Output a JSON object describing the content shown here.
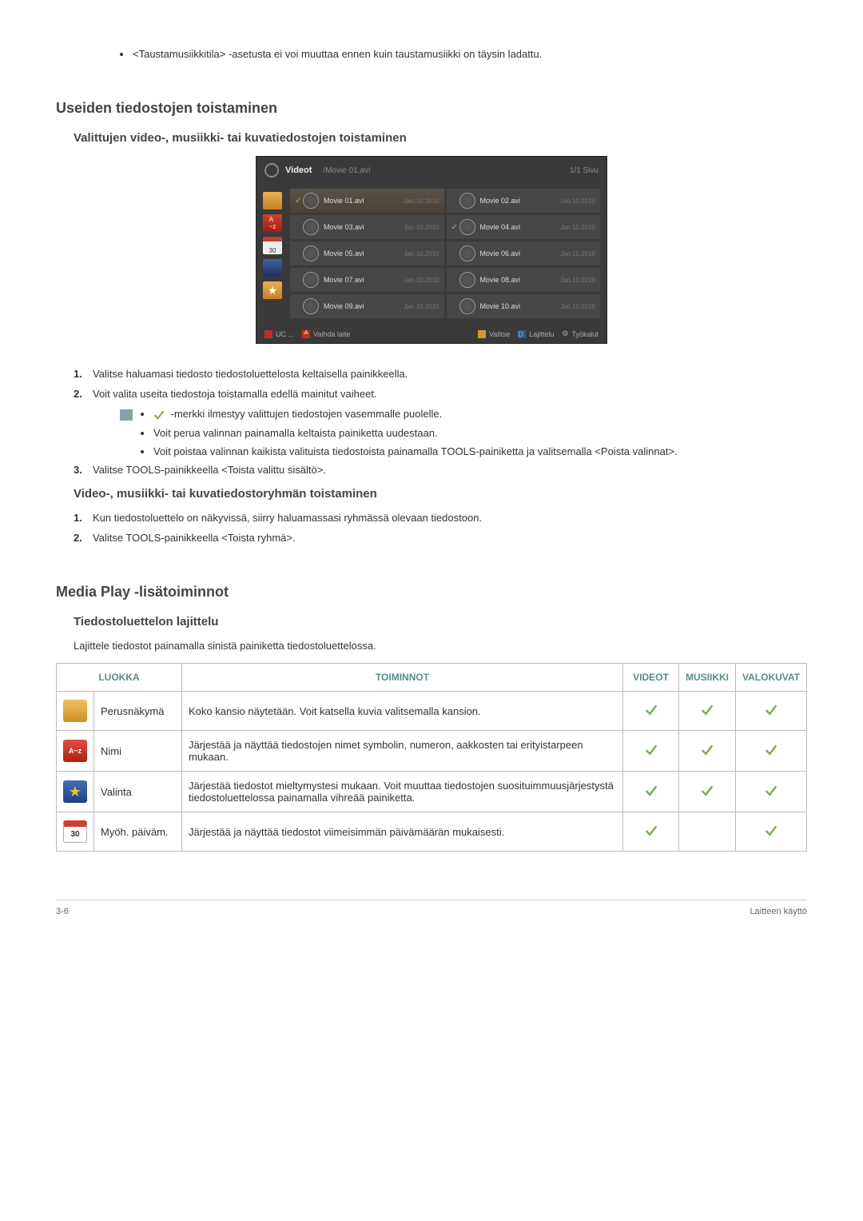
{
  "topNote": "<Taustamusiikkitila> -asetusta ei voi muuttaa ennen kuin taustamusiikki on täysin ladattu.",
  "section1": {
    "heading": "Useiden tiedostojen toistaminen",
    "sub1": {
      "heading": "Valittujen video-, musiikki- tai kuvatiedostojen toistaminen",
      "steps": {
        "s1": "Valitse haluamasi tiedosto tiedostoluettelosta keltaisella painikkeella.",
        "s2": "Voit valita useita tiedostoja toistamalla edellä mainitut vaiheet.",
        "s2a": "-merkki ilmestyy valittujen tiedostojen vasemmalle puolelle.",
        "s2b": "Voit perua valinnan painamalla keltaista painiketta uudestaan.",
        "s2c": "Voit poistaa valinnan kaikista valituista tiedostoista painamalla TOOLS-painiketta ja valitsemalla <Poista valinnat>.",
        "s3": "Valitse TOOLS-painikkeella <Toista valittu sisältö>."
      }
    },
    "sub2": {
      "heading": "Video-, musiikki- tai kuvatiedostoryhmän toistaminen",
      "s1": "Kun tiedostoluettelo on näkyvissä, siirry haluamassasi ryhmässä olevaan tiedostoon.",
      "s2": "Valitse TOOLS-painikkeella <Toista ryhmä>."
    }
  },
  "shot": {
    "title": "Videot",
    "path": "/Movie 01.avi",
    "page": "1/1 Sivu",
    "files": [
      {
        "name": "Movie 01.avi",
        "date": "Jan.10.2010",
        "checked": true,
        "hl": true
      },
      {
        "name": "Movie 02.avi",
        "date": "Jan.10.2010",
        "checked": false,
        "hl": false
      },
      {
        "name": "Movie 03.avi",
        "date": "Jan.10.2010",
        "checked": false,
        "hl": false
      },
      {
        "name": "Movie 04.avi",
        "date": "Jan.10.2010",
        "checked": true,
        "hl": false
      },
      {
        "name": "Movie 05.avi",
        "date": "Jan.10.2010",
        "checked": false,
        "hl": false
      },
      {
        "name": "Movie 06.avi",
        "date": "Jan.10.2010",
        "checked": false,
        "hl": false
      },
      {
        "name": "Movie 07.avi",
        "date": "Jan.10.2010",
        "checked": false,
        "hl": false
      },
      {
        "name": "Movie 08.avi",
        "date": "Jan.10.2010",
        "checked": false,
        "hl": false
      },
      {
        "name": "Movie 09.avi",
        "date": "Jan.10.2010",
        "checked": false,
        "hl": false
      },
      {
        "name": "Movie 10.avi",
        "date": "Jan.10.2010",
        "checked": false,
        "hl": false
      }
    ],
    "footer": {
      "uc": "UC ...",
      "device": "Vaihda laite",
      "select": "Valitse",
      "sort": "Lajittelu",
      "tools": "Työkalut"
    },
    "sideCal": "30"
  },
  "section2": {
    "heading": "Media Play -lisätoiminnot",
    "sub": "Tiedostoluettelon lajittelu",
    "desc": "Lajittele tiedostot painamalla sinistä painiketta tiedostoluettelossa."
  },
  "table": {
    "headers": {
      "cat": "LUOKKA",
      "func": "TOIMINNOT",
      "video": "VIDEOT",
      "music": "MUSIIKKI",
      "photo": "VALOKUVAT"
    },
    "rows": [
      {
        "cat": "Perusnäkymä",
        "func": "Koko kansio näytetään. Voit katsella kuvia valitsemalla kansion.",
        "v": true,
        "m": true,
        "p": true,
        "icon": "folder"
      },
      {
        "cat": "Nimi",
        "func": "Järjestää ja näyttää tiedostojen nimet symbolin, numeron, aakkosten tai erityistarpeen mukaan.",
        "v": true,
        "m": true,
        "p": true,
        "icon": "name"
      },
      {
        "cat": "Valinta",
        "func": "Järjestää tiedostot mieltymystesi mukaan. Voit muuttaa tiedostojen suosituimmuusjärjestystä tiedostoluettelossa painamalla vihreää painiketta.",
        "v": true,
        "m": true,
        "p": true,
        "icon": "star"
      },
      {
        "cat": "Myöh. päiväm.",
        "func": "Järjestää ja näyttää tiedostot viimeisimmän päivämäärän mukaisesti.",
        "v": true,
        "m": false,
        "p": true,
        "icon": "cal"
      }
    ],
    "iconText": {
      "name": "A~z",
      "cal": "30"
    }
  },
  "footer": {
    "left": "3-6",
    "right": "Laitteen käyttö"
  }
}
